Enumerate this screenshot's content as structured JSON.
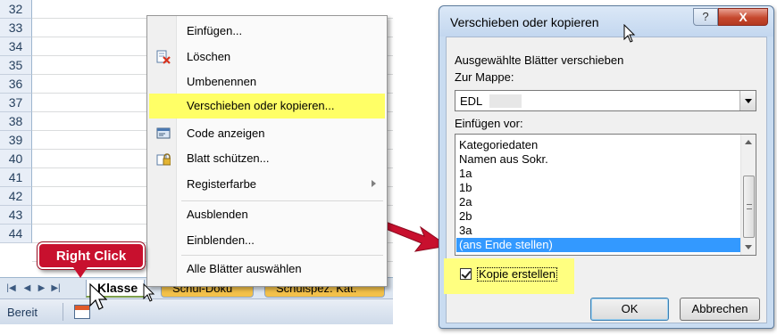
{
  "excel": {
    "row_numbers": [
      "32",
      "33",
      "34",
      "35",
      "36",
      "37",
      "38",
      "39",
      "40",
      "41",
      "42",
      "43",
      "44"
    ],
    "nav_buttons": [
      "|◀",
      "◀",
      "▶",
      "▶|"
    ],
    "sheet_tabs": [
      "Klasse",
      "Schul-Doku",
      "Schulspez. Kat."
    ],
    "status_text": "Bereit",
    "callout": "Right Click",
    "colors": {
      "callout": "#c8102e",
      "tab_inactive": "#f3c14a",
      "highlight": "#ffff66"
    }
  },
  "context_menu": {
    "items": [
      {
        "label": "Einfügen...",
        "icon": "",
        "submenu": false
      },
      {
        "label": "Löschen",
        "icon": "delete-sheet-icon",
        "submenu": false
      },
      {
        "label": "Umbenennen",
        "icon": "",
        "submenu": false
      },
      {
        "label": "Verschieben oder kopieren...",
        "icon": "",
        "submenu": false,
        "highlighted": true
      },
      {
        "label": "Code anzeigen",
        "icon": "view-code-icon",
        "submenu": false
      },
      {
        "label": "Blatt schützen...",
        "icon": "protect-sheet-icon",
        "submenu": false
      },
      {
        "label": "Registerfarbe",
        "icon": "",
        "submenu": true
      },
      {
        "label": "Ausblenden",
        "icon": "",
        "submenu": false
      },
      {
        "label": "Einblenden...",
        "icon": "",
        "submenu": false
      },
      {
        "label": "Alle Blätter auswählen",
        "icon": "",
        "submenu": false
      }
    ]
  },
  "dialog": {
    "title": "Verschieben oder kopieren",
    "help": "?",
    "close": "X",
    "move_label": "Ausgewählte Blätter verschieben",
    "workbook_label": "Zur Mappe:",
    "workbook_value": "EDL",
    "insert_before_label": "Einfügen vor:",
    "sheets": [
      "Kategoriedaten",
      "Namen aus Sokr.",
      "1a",
      "1b",
      "2a",
      "2b",
      "3a",
      "(ans Ende stellen)"
    ],
    "selected_sheet": "(ans Ende stellen)",
    "copy_checkbox_label": "Kopie erstellen",
    "copy_checked": true,
    "ok": "OK",
    "cancel": "Abbrechen"
  }
}
